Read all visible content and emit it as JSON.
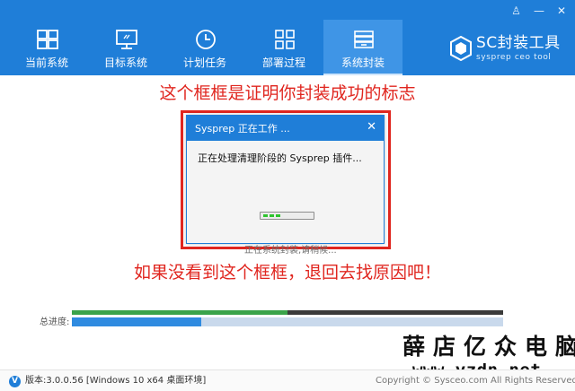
{
  "header": {
    "top_buttons": {
      "user": "♙",
      "minimize": "—",
      "close": "✕"
    },
    "nav": [
      {
        "label": "当前系统",
        "icon": "windows-icon"
      },
      {
        "label": "目标系统",
        "icon": "monitor-icon"
      },
      {
        "label": "计划任务",
        "icon": "clock-icon"
      },
      {
        "label": "部署过程",
        "icon": "grid-icon"
      },
      {
        "label": "系统封装",
        "icon": "package-icon",
        "active": true
      }
    ],
    "logo": {
      "title": "SC封装工具",
      "subtitle": "sysprep ceo tool"
    }
  },
  "annotations": {
    "top": "这个框框是证明你封装成功的标志",
    "bottom": "如果没看到这个框框，退回去找原因吧！"
  },
  "dialog": {
    "title": "Sysprep 正在工作 ...",
    "close": "✕",
    "message": "正在处理清理阶段的 Sysprep 插件..."
  },
  "status_text": "正在系统封装,请稍候...",
  "progress": {
    "label": "总进度:",
    "step_fraction": 0.5,
    "total_fraction": 0.3
  },
  "watermark": {
    "line1": "薛店亿众电脑",
    "line2": "www.yzdn.net"
  },
  "footer": {
    "badge": "V",
    "version": "版本:3.0.0.56 [Windows 10 x64 桌面环境]",
    "copyright": "Copyright © Sysceo.com All Rights Reserved."
  },
  "colors": {
    "header_blue": "#1f7ed8",
    "active_tab": "#3f95e6",
    "annotation_red": "#e0261f",
    "progress_green": "#3aa34a",
    "progress_blue": "#2f8be0"
  }
}
